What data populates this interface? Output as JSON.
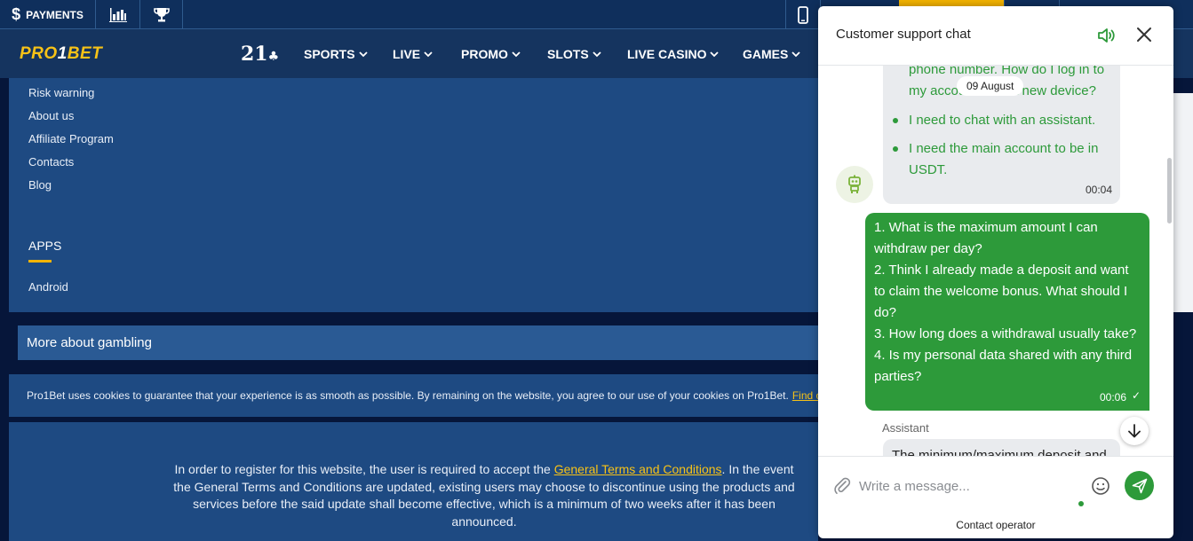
{
  "topbar": {
    "payments_icon": "dollar-icon",
    "payments_symbol": "$",
    "payments_label": "PAYMENTS",
    "stats_icon": "bar-chart-icon",
    "trophy_icon": "trophy-icon",
    "mobile_icon": "mobile-phone-icon",
    "accent": "#f5b400"
  },
  "nav": {
    "logo_pro": "PRO",
    "logo_one": "1",
    "logo_bet": "BET",
    "twentyone": "21",
    "twentyone_suit": "♣",
    "items": [
      {
        "label": "SPORTS"
      },
      {
        "label": "LIVE"
      },
      {
        "label": "PROMO"
      },
      {
        "label": "SLOTS"
      },
      {
        "label": "LIVE CASINO"
      },
      {
        "label": "GAMES"
      }
    ],
    "chevron": "⌄"
  },
  "footer": {
    "links": [
      "Risk warning",
      "About us",
      "Affiliate Program",
      "Contacts",
      "Blog"
    ],
    "apps_title": "APPS",
    "apps_links": [
      "Android"
    ],
    "more_gambling": "More about gambling",
    "cookie_text": "Pro1Bet uses cookies to guarantee that your experience is as smooth as possible. By remaining on the website, you agree to our use of your cookies on Pro1Bet.",
    "cookie_link": "Find o",
    "reg_text_before": "In order to register for this website, the user is required to accept the ",
    "reg_link": "General Terms and Conditions",
    "reg_text_after": ". In the event the General Terms and Conditions are updated, existing users may choose to discontinue using the products and services before the said update shall become effective, which is a minimum of two weeks after it has been announced."
  },
  "chat": {
    "title": "Customer support chat",
    "date_label": "09 August",
    "bot_lines": {
      "phone1": "phone number. How do I log in to",
      "phone2": "my account from a new device?",
      "item1": "I need to chat with an assistant.",
      "item2a": "I need the main account to be in",
      "item2b": "USDT."
    },
    "bot_time": "00:04",
    "user_lines": [
      "1. What is the maximum amount I can",
      "withdraw per day?",
      "2. Think I already made a deposit and want",
      "to claim the welcome bonus. What should I",
      "do?",
      "3. How long does a withdrawal usually take?",
      "4. Is my personal data shared with any third",
      "parties?"
    ],
    "user_time": "00:06",
    "user_check": "✓",
    "assistant_label": "Assistant",
    "assistant_partial": "The minimum/maximum deposit and",
    "input_placeholder": "Write a message...",
    "contact_operator": "Contact operator",
    "accent": "#2d9a3a"
  }
}
